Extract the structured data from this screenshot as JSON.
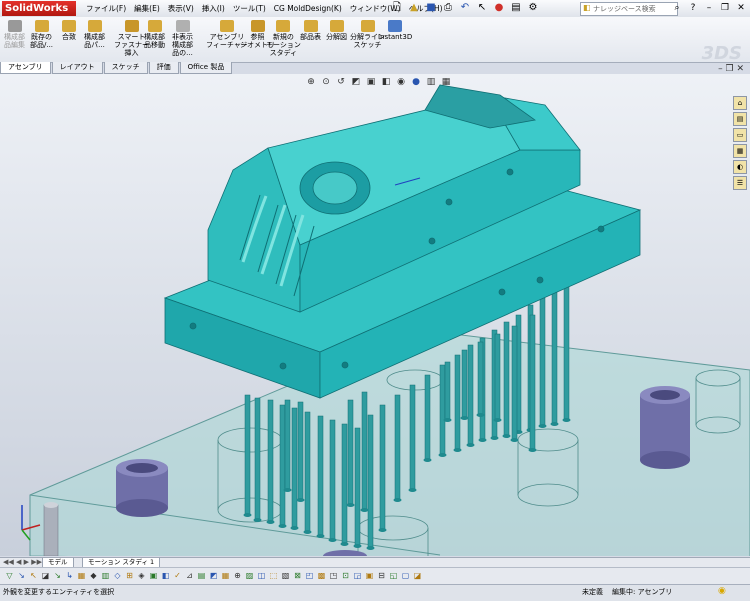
{
  "app": {
    "logo_text": "SolidWorks"
  },
  "menu": [
    "ファイル(F)",
    "編集(E)",
    "表示(V)",
    "挿入(I)",
    "ツール(T)",
    "CG MoldDesign(K)",
    "ウィンドウ(W)",
    "ヘルプ(H)"
  ],
  "search": {
    "placeholder": "ナレッジベース検索"
  },
  "ribbon": {
    "items": [
      {
        "label": "構成部\n品編集",
        "icon": "edit-component-icon",
        "disabled": true
      },
      {
        "label": "既存の\n部品/...",
        "icon": "insert-component-icon"
      },
      {
        "label": "合致",
        "icon": "mate-icon"
      },
      {
        "label": "構成部\n品パ...",
        "icon": "component-pattern-icon"
      },
      {
        "label": "スマート\nファスナー\n挿入",
        "icon": "smart-fastener-icon"
      },
      {
        "label": "構成部\n品移動",
        "icon": "move-component-icon"
      },
      {
        "label": "非表示\n構成部\n品の...",
        "icon": "hide-component-icon"
      },
      {
        "label": "アセンブリ\nフィーチャー",
        "icon": "assembly-feature-icon"
      },
      {
        "label": "参照\nジオメトリ",
        "icon": "reference-geometry-icon"
      },
      {
        "label": "新規の\nモーション\nスタディ",
        "icon": "motion-study-icon"
      },
      {
        "label": "部品表",
        "icon": "bom-icon"
      },
      {
        "label": "分解図",
        "icon": "exploded-view-icon"
      },
      {
        "label": "分解ライン\nスケッチ",
        "icon": "explode-line-icon"
      },
      {
        "label": "Instant3D",
        "icon": "instant3d-icon"
      }
    ]
  },
  "command_tabs": [
    "アセンブリ",
    "レイアウト",
    "スケッチ",
    "評価",
    "Office 製品"
  ],
  "bottom_tabs": [
    "モデル",
    "モーション スタディ 1"
  ],
  "status": {
    "message": "外観を変更するエンティティを選択",
    "state": "未定義",
    "edit_mode": "編集中: アセンブリ"
  },
  "colors": {
    "part": "#2fbdbd",
    "part_dark": "#1a8f95",
    "plate": "#a9d8d6"
  }
}
